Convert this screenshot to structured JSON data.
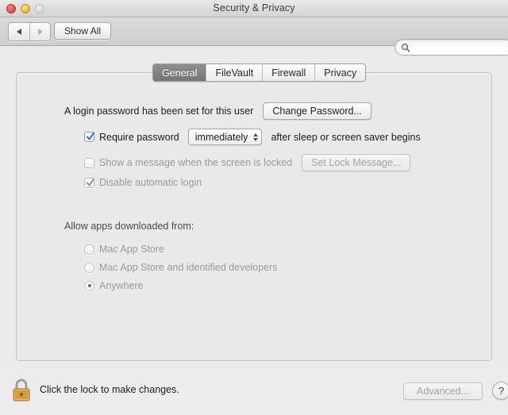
{
  "window": {
    "title": "Security & Privacy",
    "traffic_lights": [
      "close-button",
      "minimize-button",
      "zoom-button"
    ]
  },
  "toolbar": {
    "back_icon": "arrow-left-icon",
    "forward_icon": "arrow-right-icon",
    "show_all_label": "Show All",
    "search": {
      "icon": "search-icon",
      "value": "",
      "placeholder": ""
    }
  },
  "tabs": [
    {
      "label": "General",
      "selected": true
    },
    {
      "label": "FileVault",
      "selected": false
    },
    {
      "label": "Firewall",
      "selected": false
    },
    {
      "label": "Privacy",
      "selected": false
    }
  ],
  "general": {
    "login_password_text": "A login password has been set for this user",
    "change_password_label": "Change Password...",
    "require_password": {
      "checked": true,
      "enabled": true,
      "label": "Require password",
      "interval_value": "immediately",
      "suffix_label": "after sleep or screen saver begins"
    },
    "show_message": {
      "checked": false,
      "enabled": false,
      "label": "Show a message when the screen is locked",
      "button_label": "Set Lock Message..."
    },
    "disable_auto_login": {
      "checked": true,
      "enabled": false,
      "label": "Disable automatic login"
    },
    "allow_apps": {
      "section_label": "Allow apps downloaded from:",
      "options": [
        {
          "label": "Mac App Store",
          "selected": false
        },
        {
          "label": "Mac App Store and identified developers",
          "selected": false
        },
        {
          "label": "Anywhere",
          "selected": true
        }
      ]
    }
  },
  "bottom": {
    "lock_icon": "lock-closed-icon",
    "lock_text": "Click the lock to make changes.",
    "advanced_label": "Advanced...",
    "advanced_enabled": false,
    "help_label": "?"
  },
  "colors": {
    "checkbox_checked": "#3a76d8",
    "checkbox_disabled": "#9a9a9a",
    "tab_selected_bg": "#7d7d7d",
    "lock_body": "#d9a441",
    "window_bg": "#ebebeb",
    "content_bg": "#e9e9e9"
  }
}
